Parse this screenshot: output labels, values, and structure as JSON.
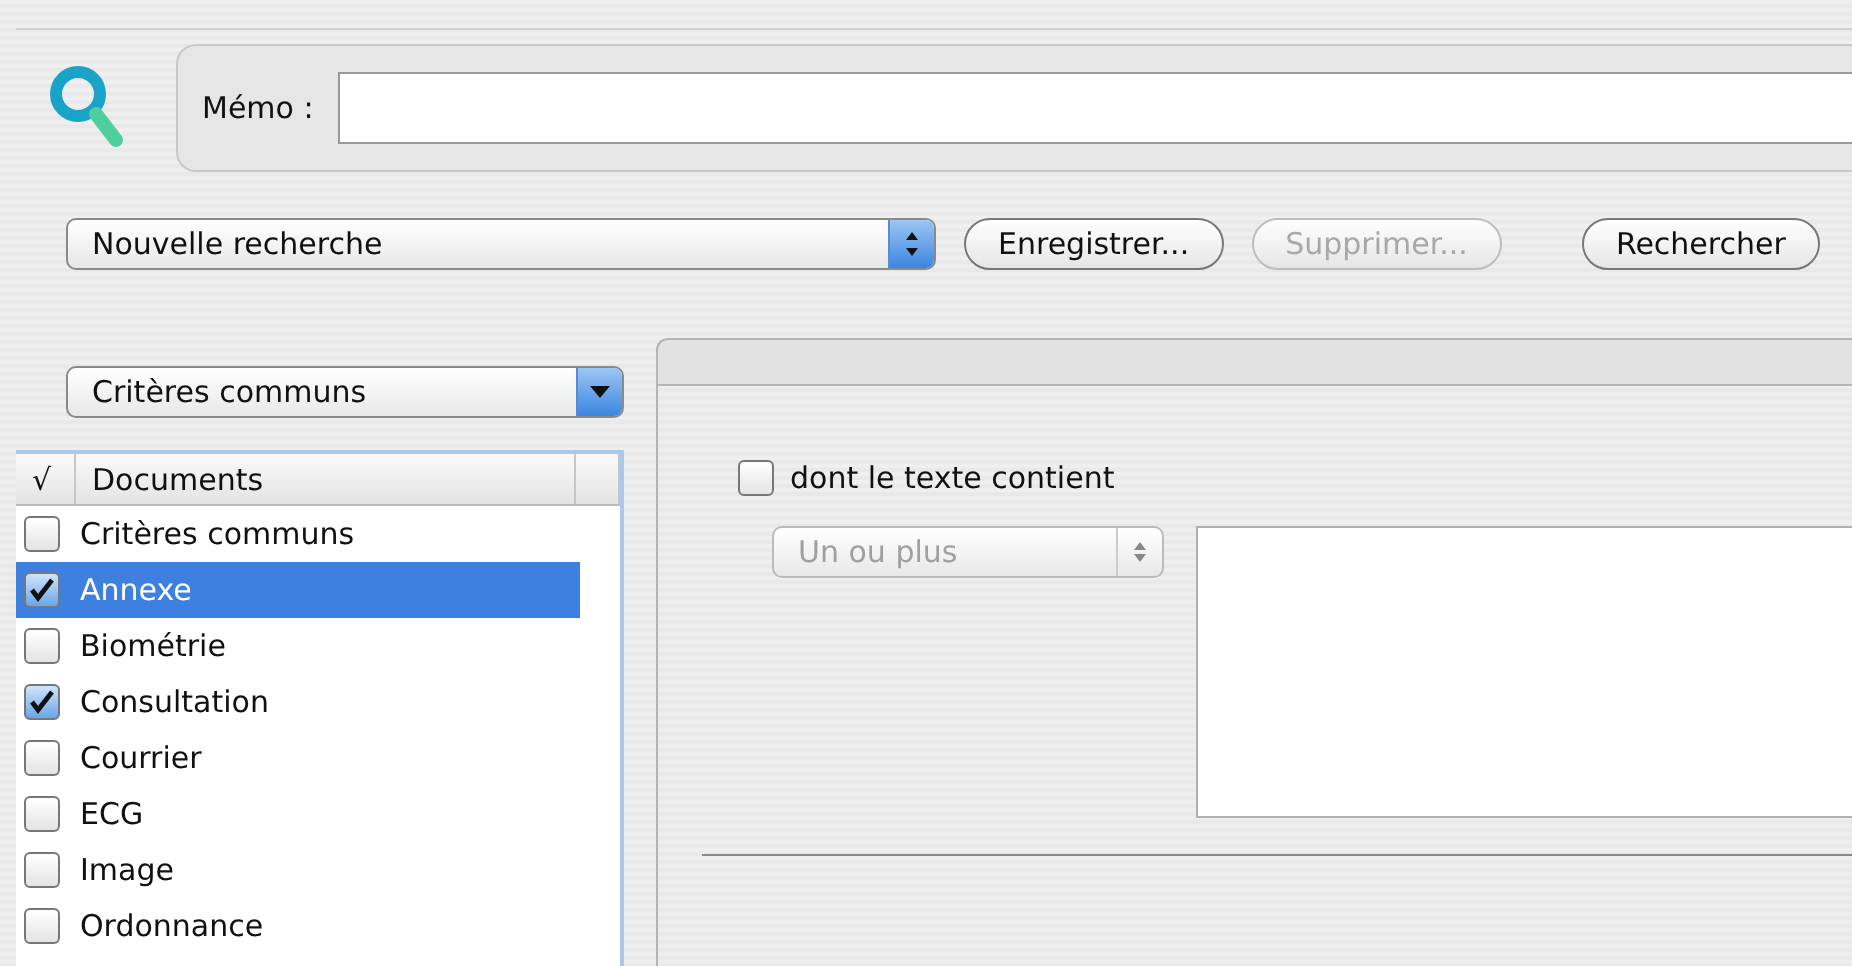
{
  "memo": {
    "label": "Mémo :"
  },
  "search_bar": {
    "saved_search": "Nouvelle recherche",
    "buttons": [
      {
        "label": "Enregistrer...",
        "disabled": false
      },
      {
        "label": "Supprimer...",
        "disabled": true
      },
      {
        "label": "Rechercher",
        "disabled": false
      }
    ]
  },
  "category_popup": "Critères communs",
  "table": {
    "columns": [
      "√",
      "Documents"
    ],
    "rows": [
      {
        "label": "Critères communs",
        "checked": false,
        "selected": false
      },
      {
        "label": "Annexe",
        "checked": true,
        "selected": true
      },
      {
        "label": "Biométrie",
        "checked": false,
        "selected": false
      },
      {
        "label": "Consultation",
        "checked": true,
        "selected": false
      },
      {
        "label": "Courrier",
        "checked": false,
        "selected": false
      },
      {
        "label": "ECG",
        "checked": false,
        "selected": false
      },
      {
        "label": "Image",
        "checked": false,
        "selected": false
      },
      {
        "label": "Ordonnance",
        "checked": false,
        "selected": false
      }
    ]
  },
  "criteria": {
    "text_filter": {
      "label": "dont le texte contient",
      "checked": false
    },
    "mode_popup": {
      "value": "Un ou plus",
      "disabled": true
    }
  }
}
